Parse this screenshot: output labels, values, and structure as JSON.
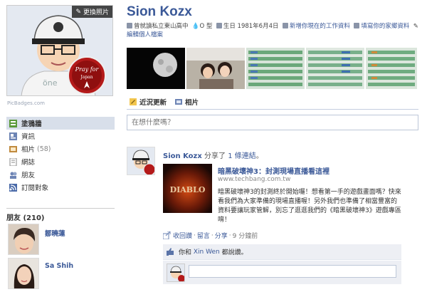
{
  "left": {
    "change_photo_label": "更換照片",
    "badge_text": "Pray for Japan",
    "pic_badges": "PicBadges.com",
    "nav_items": [
      {
        "label": "塗鴉牆",
        "icon": "wall-icon",
        "count": ""
      },
      {
        "label": "資訊",
        "icon": "info-icon",
        "count": ""
      },
      {
        "label": "相片",
        "icon": "photos-icon",
        "count": "(58)"
      },
      {
        "label": "網誌",
        "icon": "notes-icon",
        "count": ""
      },
      {
        "label": "朋友",
        "icon": "friends-icon",
        "count": ""
      },
      {
        "label": "訂閱對象",
        "icon": "subscriptions-icon",
        "count": ""
      }
    ],
    "friends_header": "朋友 (210)",
    "friends": [
      {
        "name": "鄒曉蓮"
      },
      {
        "name": "Sa Shih"
      }
    ]
  },
  "main": {
    "profile_name": "Sion Kozx",
    "info": {
      "school": "曾就讀私立東山高中",
      "blood": "O 型",
      "birthday": "生日 1981年6月4日",
      "add_work": "新增你現在的工作資料",
      "fill_hometown": "填寫你的家鄉資料",
      "edit_profile": "編輯個人檔案"
    },
    "tabs": [
      {
        "label": "近況更新",
        "icon": "status-icon"
      },
      {
        "label": "相片",
        "icon": "photo-tab-icon"
      }
    ],
    "status_placeholder": "在想什麼嗎？",
    "story": {
      "author": "Sion Kozx",
      "verb": "分享了",
      "link_word": "1 條連結",
      "trail": "。",
      "attachment": {
        "thumb_text": "DIABLO",
        "title": "暗黑破壞神3：封測現場直播看這裡",
        "url": "www.techbang.com.tw",
        "description": "暗黑破壞神3的封測終於開始囉！想看第一手的遊戲畫面嗎？快來看我們為大家準備的現場直播喔！另外我們也準備了相當豐富的資料要讓玩家管解，別忘了逛逛我們的《暗黑破壞神3》遊戲專區唷！"
      },
      "actions": {
        "unlike": "收回讚",
        "comment": "留言",
        "share": "分享",
        "time": "9 分鐘前"
      },
      "likes": {
        "you": "你和",
        "friend": "Xin Wen",
        "suffix": "都說讚。"
      }
    }
  },
  "colors": {
    "link": "#3b5998",
    "nav_active_bg": "#d8dfea",
    "ufi_bg": "#edeff4"
  }
}
